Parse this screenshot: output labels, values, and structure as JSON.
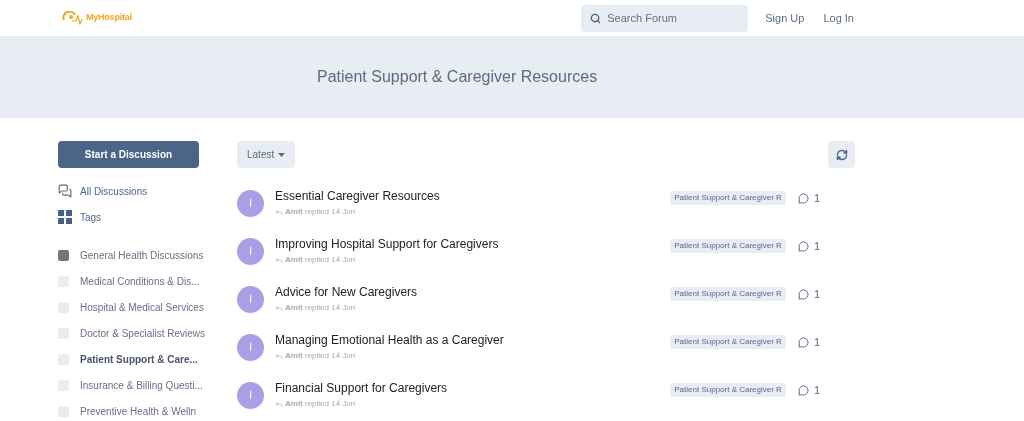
{
  "header": {
    "logo": "MyHospital",
    "search": {
      "placeholder": "Search Forum"
    },
    "links": [
      "Sign Up",
      "Log In"
    ]
  },
  "hero": {
    "title": "Patient Support & Caregiver Resources"
  },
  "sidebar": {
    "start_button": "Start a Discussion",
    "nav": [
      {
        "label": "All Discussions",
        "kind": "discussions"
      },
      {
        "label": "Tags",
        "kind": "tags"
      }
    ],
    "categories": [
      {
        "label": "General Health Discussions",
        "color": "#767676",
        "selected": false
      },
      {
        "label": "Medical Conditions & Dis...",
        "color": "#e8ecf3",
        "selected": false
      },
      {
        "label": "Hospital & Medical Services",
        "color": "#e8ecf3",
        "selected": false
      },
      {
        "label": "Doctor & Specialist Reviews",
        "color": "#e8ecf3",
        "selected": false
      },
      {
        "label": "Patient Support & Care...",
        "color": "#e8ecf3",
        "selected": true
      },
      {
        "label": "Insurance & Billing Questi...",
        "color": "#e8ecf3",
        "selected": false
      },
      {
        "label": "Preventive Health & Welln",
        "color": "#e8ecf3",
        "selected": false
      }
    ]
  },
  "toolbar": {
    "sort": "Latest"
  },
  "discussions": [
    {
      "avatar": "I",
      "title": "Essential Caregiver Resources",
      "meta": "**Amit** replied 14 Jun",
      "tag": "Patient Support & Caregiver R",
      "replies": "1"
    },
    {
      "avatar": "I",
      "title": "Improving Hospital Support for Caregivers",
      "meta": "**Amit** replied 14 Jun",
      "tag": "Patient Support & Caregiver R",
      "replies": "1"
    },
    {
      "avatar": "I",
      "title": "Advice for New Caregivers",
      "meta": "**Amit** replied 14 Jun",
      "tag": "Patient Support & Caregiver R",
      "replies": "1"
    },
    {
      "avatar": "I",
      "title": "Managing Emotional Health as a Caregiver",
      "meta": "**Amit** replied 14 Jun",
      "tag": "Patient Support & Caregiver R",
      "replies": "1"
    },
    {
      "avatar": "I",
      "title": "Financial Support for Caregivers",
      "meta": "**Amit** replied 14 Jun",
      "tag": "Patient Support & Caregiver R",
      "replies": "1"
    }
  ]
}
